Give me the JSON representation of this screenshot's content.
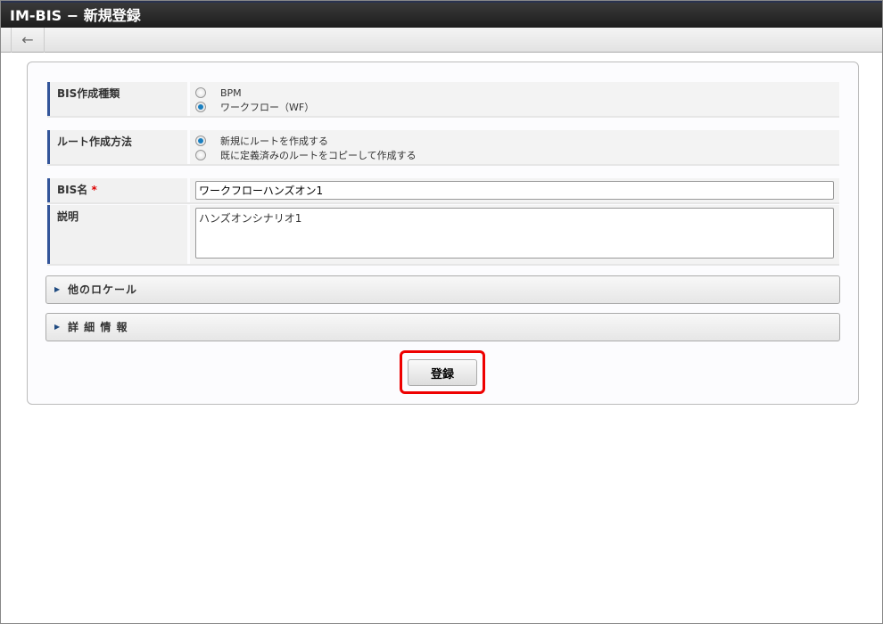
{
  "window": {
    "title_app": "IM-BIS",
    "title_sep": " − ",
    "title_page": "新規登録"
  },
  "toolbar": {
    "back_icon": "←"
  },
  "form": {
    "bis_type": {
      "label": "BIS作成種類",
      "options": [
        {
          "label": "BPM",
          "selected": false
        },
        {
          "label": "ワークフロー（WF）",
          "selected": true
        }
      ]
    },
    "route_method": {
      "label": "ルート作成方法",
      "options": [
        {
          "label": "新規にルートを作成する",
          "selected": true
        },
        {
          "label": "既に定義済みのルートをコピーして作成する",
          "selected": false
        }
      ]
    },
    "bis_name": {
      "label": "BIS名",
      "required": "*",
      "value": "ワークフローハンズオン1"
    },
    "description": {
      "label": "説明",
      "value": "ハンズオンシナリオ1"
    }
  },
  "sections": {
    "other_locale": "他のロケール",
    "details": "詳 細 情 報"
  },
  "actions": {
    "register": "登録"
  }
}
